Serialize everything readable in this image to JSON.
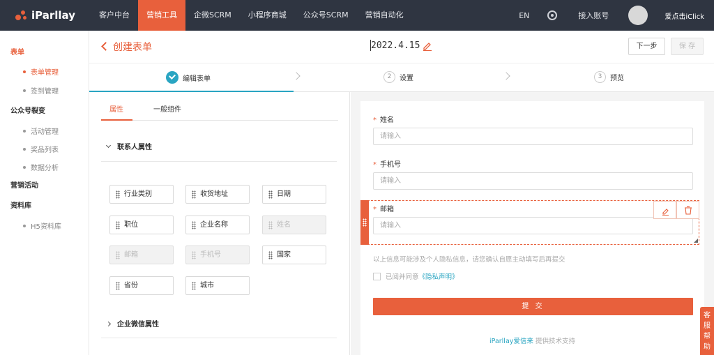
{
  "topbar": {
    "logo": "iParllay",
    "nav": [
      "客户中台",
      "营销工具",
      "企微SCRM",
      "小程序商城",
      "公众号SCRM",
      "营销自动化"
    ],
    "lang": "EN",
    "connect_account": "接入账号",
    "username": "爱点击iClick"
  },
  "sidebar": {
    "groups": [
      {
        "label": "表单",
        "items": [
          "表单管理",
          "签到管理"
        ]
      },
      {
        "label": "公众号裂变",
        "items": [
          "活动管理",
          "奖品列表",
          "数据分析"
        ]
      },
      {
        "label": "营销活动",
        "items": []
      },
      {
        "label": "资料库",
        "items": [
          "H5资料库"
        ]
      }
    ]
  },
  "header": {
    "back_title": "创建表单",
    "date": "2022.4.15",
    "next_label": "下一步",
    "save_label": "保 存"
  },
  "steps": [
    {
      "num": "1",
      "label": "编辑表单",
      "done": true
    },
    {
      "num": "2",
      "label": "设置"
    },
    {
      "num": "3",
      "label": "预览"
    }
  ],
  "left_panel": {
    "tabs": [
      "属性",
      "一般组件"
    ],
    "section1": "联系人属性",
    "chips": [
      {
        "label": "行业类别"
      },
      {
        "label": "收货地址"
      },
      {
        "label": "日期"
      },
      {
        "label": "职位"
      },
      {
        "label": "企业名称"
      },
      {
        "label": "姓名",
        "disabled": true
      },
      {
        "label": "邮箱",
        "disabled": true
      },
      {
        "label": "手机号",
        "disabled": true
      },
      {
        "label": "国家"
      },
      {
        "label": "省份"
      },
      {
        "label": "城市"
      }
    ],
    "section2": "企业微信属性"
  },
  "form": {
    "fields": [
      {
        "label": "姓名",
        "placeholder": "请输入"
      },
      {
        "label": "手机号",
        "placeholder": "请输入"
      },
      {
        "label": "邮箱",
        "placeholder": "请输入"
      }
    ],
    "privacy_note": "以上信息可能涉及个人隐私信息，请您确认自愿主动填写后再提交",
    "agree_prefix": "已阅并同意",
    "agree_link": "《隐私声明》",
    "submit_label": "提 交",
    "footer_brand": "iParllay爱信来",
    "footer_suffix": "提供技术支持"
  },
  "help_label": "客服帮助",
  "colors": {
    "accent": "#e8603c",
    "teal": "#2aa5c2",
    "topbar": "#2f3541"
  }
}
